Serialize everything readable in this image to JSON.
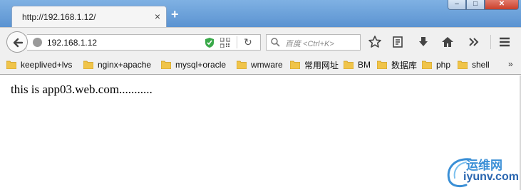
{
  "tab": {
    "title": "http://192.168.1.12/",
    "close_glyph": "×",
    "new_tab_glyph": "+"
  },
  "window_controls": {
    "minimize": "–",
    "maximize": "□",
    "close": "✕"
  },
  "navbar": {
    "url": "192.168.1.12",
    "reload_glyph": "↻",
    "search_placeholder": "百度 <Ctrl+K>",
    "icons": [
      "back-icon",
      "globe-icon",
      "shield-icon",
      "qr-code-icon",
      "reload-icon",
      "search-icon",
      "star-icon",
      "reading-list-icon",
      "download-icon",
      "home-icon",
      "overflow-chevrons-icon",
      "menu-icon"
    ]
  },
  "bookmarks": {
    "items": [
      "keeplived+lvs",
      "nginx+apache",
      "mysql+oracle",
      "wmware",
      "常用网址",
      "BM",
      "数据库",
      "php",
      "shell"
    ],
    "more_glyph": "»"
  },
  "content": {
    "text": "this is app03.web.com..........."
  },
  "watermark": {
    "cn": "运维网",
    "en": "iyunv.com"
  },
  "colors": {
    "titlebar": "#6aa2da",
    "folder": "#f0c44a",
    "shield": "#3aa94a",
    "watermark": "#2a66b0"
  }
}
